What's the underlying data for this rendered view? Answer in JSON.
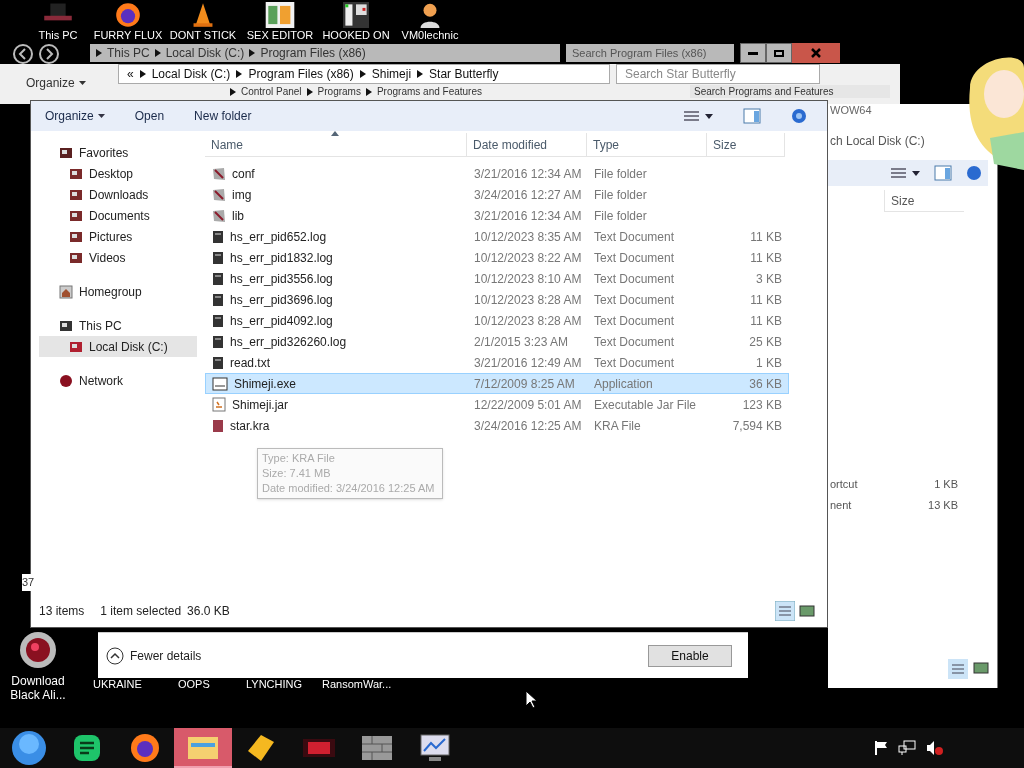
{
  "desktop_icons": [
    {
      "label": "This PC",
      "kind": "hat"
    },
    {
      "label": "FURRY FLUX",
      "kind": "browser"
    },
    {
      "label": "DONT STICK",
      "kind": "cone"
    },
    {
      "label": "SEX EDITOR",
      "kind": "hex"
    },
    {
      "label": "HOOKED ON",
      "kind": "game"
    },
    {
      "label": "VM0lechnic",
      "kind": "person"
    }
  ],
  "back_window": {
    "breadcrumb": [
      "This PC",
      "Local Disk (C:)",
      "Program Files (x86)"
    ],
    "search": {
      "placeholder": "Search Program Files (x86)"
    }
  },
  "mid_window": {
    "organize": "Organize",
    "breadcrumb": [
      "Control Panel",
      "Programs",
      "Programs and Features"
    ],
    "search": {
      "placeholder": "Search Programs and Features"
    }
  },
  "main_window": {
    "address": {
      "overflow": "«",
      "breadcrumb": [
        "Local Disk (C:)",
        "Program Files (x86)",
        "Shimeji",
        "Star Butterfly"
      ]
    },
    "search": {
      "placeholder": "Search Star Butterfly"
    },
    "toolbar": [
      {
        "label": "Organize",
        "dropdown": true
      },
      {
        "label": "Open",
        "dropdown": false
      },
      {
        "label": "New folder",
        "dropdown": false
      }
    ],
    "nav": [
      {
        "label": "Favorites",
        "kind": "star",
        "selected": false,
        "children": [
          {
            "label": "Desktop",
            "kind": "folder",
            "selected": false
          },
          {
            "label": "Downloads",
            "kind": "folder",
            "selected": false
          },
          {
            "label": "Documents",
            "kind": "folder",
            "selected": false
          },
          {
            "label": "Pictures",
            "kind": "folder",
            "selected": false
          },
          {
            "label": "Videos",
            "kind": "folder",
            "selected": false
          }
        ]
      },
      {
        "label": "Homegroup",
        "kind": "home",
        "selected": false
      },
      {
        "label": "This PC",
        "kind": "pc",
        "selected": false,
        "children": [
          {
            "label": "Local Disk (C:)",
            "kind": "disk",
            "selected": true
          }
        ]
      },
      {
        "label": "Network",
        "kind": "network",
        "selected": false
      }
    ],
    "columns": [
      "Name",
      "Date modified",
      "Type",
      "Size"
    ],
    "rows": [
      {
        "name": "conf",
        "date": "3/21/2016 12:34 AM",
        "type": "File folder",
        "kind": "folder",
        "selected": false
      },
      {
        "name": "img",
        "date": "3/24/2016 12:27 AM",
        "type": "File folder",
        "kind": "folder",
        "selected": false
      },
      {
        "name": "lib",
        "date": "3/21/2016 12:34 AM",
        "type": "File folder",
        "kind": "folder",
        "selected": false
      },
      {
        "name": "hs_err_pid652.log",
        "date": "10/12/2023 8:35 AM",
        "type": "Text Document",
        "size": "11 KB",
        "kind": "doc",
        "selected": false
      },
      {
        "name": "hs_err_pid1832.log",
        "date": "10/12/2023 8:22 AM",
        "type": "Text Document",
        "size": "11 KB",
        "kind": "doc",
        "selected": false
      },
      {
        "name": "hs_err_pid3556.log",
        "date": "10/12/2023 8:10 AM",
        "type": "Text Document",
        "size": "3 KB",
        "kind": "doc",
        "selected": false
      },
      {
        "name": "hs_err_pid3696.log",
        "date": "10/12/2023 8:28 AM",
        "type": "Text Document",
        "size": "11 KB",
        "kind": "doc",
        "selected": false
      },
      {
        "name": "hs_err_pid4092.log",
        "date": "10/12/2023 8:28 AM",
        "type": "Text Document",
        "size": "11 KB",
        "kind": "doc",
        "selected": false
      },
      {
        "name": "hs_err_pid326260.log",
        "date": "2/1/2015 3:23 AM",
        "type": "Text Document",
        "size": "25 KB",
        "kind": "doc",
        "selected": false
      },
      {
        "name": "read.txt",
        "date": "3/21/2016 12:49 AM",
        "type": "Text Document",
        "size": "1 KB",
        "kind": "doc",
        "selected": false
      },
      {
        "name": "Shimeji.exe",
        "date": "7/12/2009 8:25 AM",
        "type": "Application",
        "size": "36 KB",
        "kind": "exe",
        "selected": true
      },
      {
        "name": "Shimeji.jar",
        "date": "12/22/2009 5:01 AM",
        "type": "Executable Jar File",
        "size": "123 KB",
        "kind": "jar",
        "selected": false
      },
      {
        "name": "star.kra",
        "date": "3/24/2016 12:25 AM",
        "type": "KRA File",
        "size": "7,594 KB",
        "kind": "kra",
        "selected": false
      }
    ],
    "tooltip": [
      "Type: KRA File",
      "Size: 7.41 MB",
      "Date modified: 3/24/2016 12:25 AM"
    ],
    "status": {
      "count": "13 items",
      "selection": "1 item selected",
      "size": "36.0 KB"
    }
  },
  "right_window": {
    "search_fragment": "ch Local Disk (C:)",
    "path_fragment": "WOW64",
    "column": "Size",
    "rows": [
      {
        "name": "ortcut",
        "size": "1 KB"
      },
      {
        "name": "nent",
        "size": "13 KB"
      }
    ]
  },
  "dialog": {
    "toggle": "Fewer details",
    "button": "Enable"
  },
  "bottom_labels": [
    "UKRAINE",
    "OOPS",
    "LYNCHING",
    "RansomWar..."
  ],
  "left_fragment": "37",
  "download_icon": {
    "label": "Download Black Ali..."
  },
  "taskbar": [
    {
      "kind": "orb",
      "selected": false
    },
    {
      "kind": "notes",
      "selected": false
    },
    {
      "kind": "browser",
      "selected": false
    },
    {
      "kind": "explorer",
      "selected": true
    },
    {
      "kind": "box",
      "selected": false
    },
    {
      "kind": "game",
      "selected": false
    },
    {
      "kind": "wall",
      "selected": false
    },
    {
      "kind": "monitor",
      "selected": false
    }
  ]
}
